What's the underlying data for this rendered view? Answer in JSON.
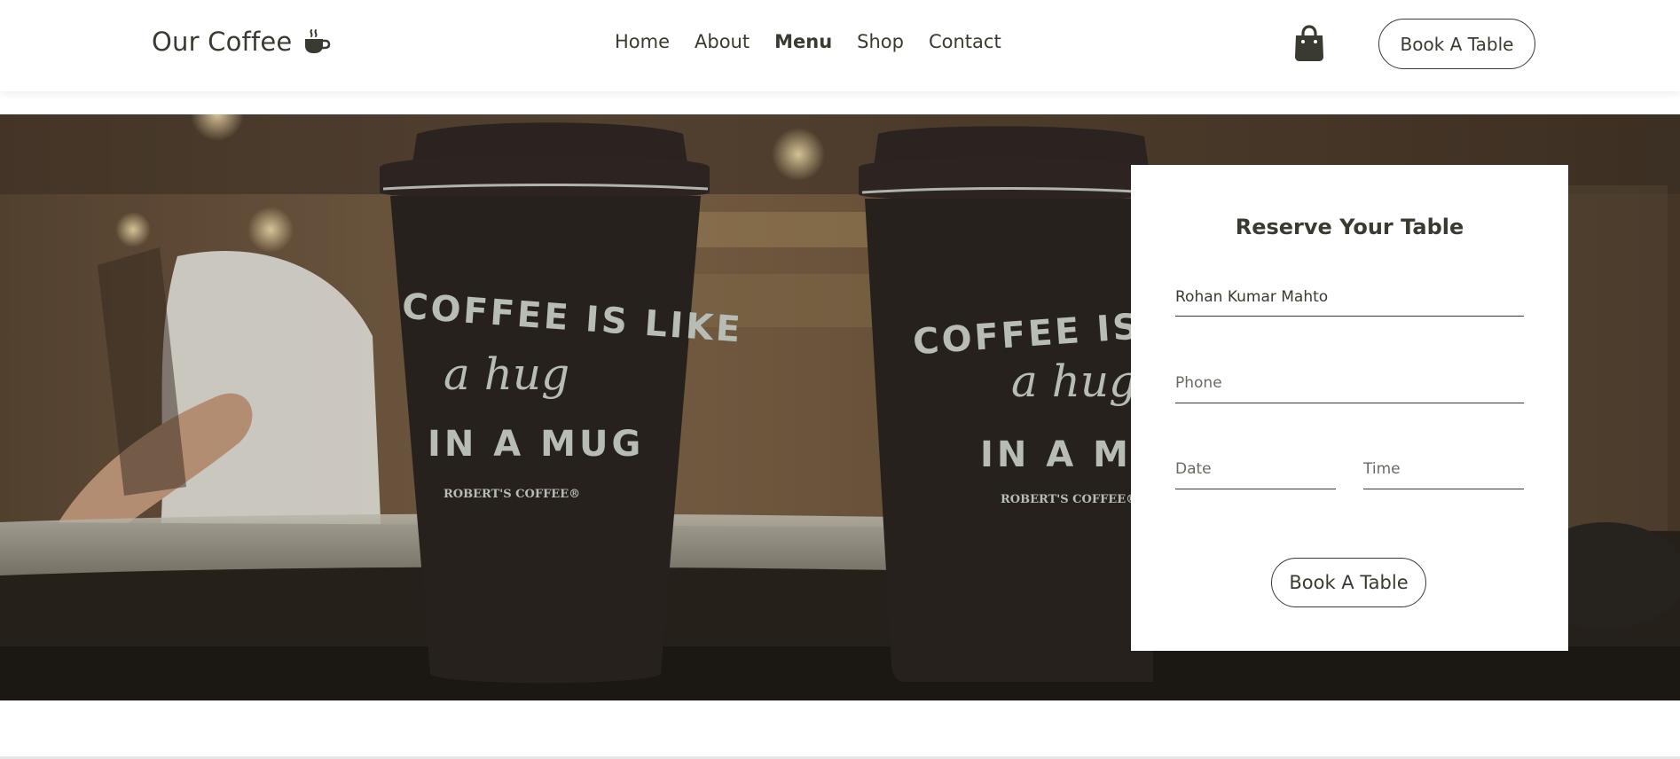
{
  "header": {
    "logo_text": "Our Coffee",
    "logo_icon": "coffee-cup-icon",
    "nav": [
      {
        "label": "Home",
        "active": false
      },
      {
        "label": "About",
        "active": false
      },
      {
        "label": "Menu",
        "active": true
      },
      {
        "label": "Shop",
        "active": false
      },
      {
        "label": "Contact",
        "active": false
      }
    ],
    "bag_icon": "shopping-bag-icon",
    "book_label": "Book A Table"
  },
  "hero": {
    "cup_left": {
      "line1": "COFFEE IS LIKE",
      "line2": "a hug",
      "line3": "IN A MUG",
      "brand": "ROBERT'S COFFEE®"
    },
    "cup_right": {
      "line1": "COFFEE IS",
      "line2": "a hug",
      "line3": "IN A MUG",
      "brand": "ROBERT'S COFFEE®"
    }
  },
  "reservation": {
    "title": "Reserve Your Table",
    "name_value": "Rohan Kumar Mahto",
    "phone_placeholder": "Phone",
    "date_placeholder": "Date",
    "time_placeholder": "Time",
    "book_label": "Book A Table"
  },
  "colors": {
    "text": "#3b3a30",
    "background": "#ffffff",
    "hero_dark": "#2a211b"
  }
}
